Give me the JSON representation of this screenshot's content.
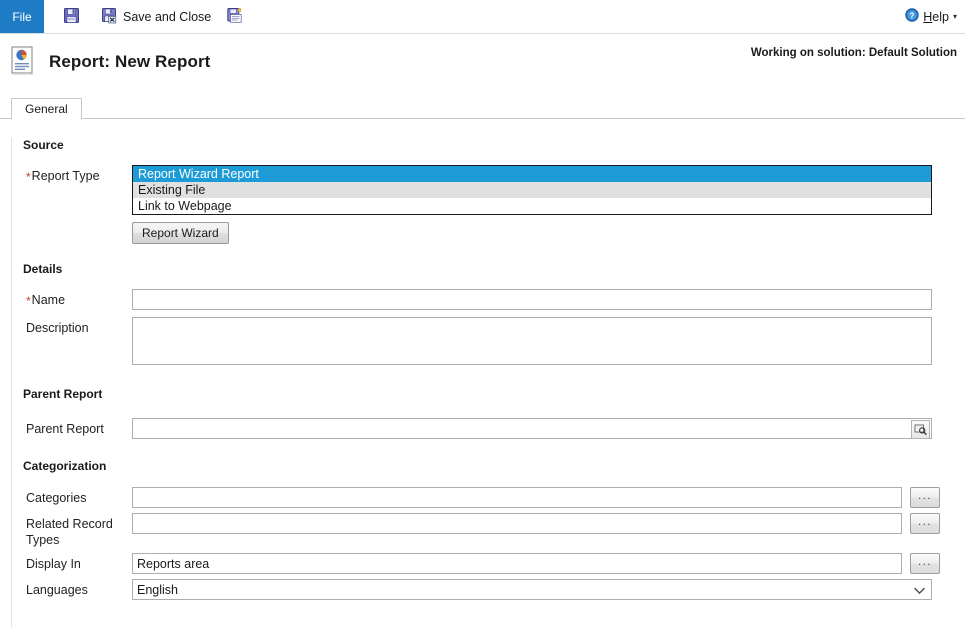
{
  "ribbon": {
    "file_tab": "File",
    "commands": [
      {
        "name": "save",
        "label": "",
        "icon": "save-icon"
      },
      {
        "name": "save-and-close",
        "label": "Save and Close",
        "icon": "save-and-close-icon"
      },
      {
        "name": "save-and-new",
        "label": "",
        "icon": "save-and-new-icon"
      }
    ],
    "help_label": "Help",
    "help_accesskey": "H",
    "help_caret": "▾"
  },
  "header": {
    "title": "Report: New Report",
    "icon": "report-document-icon",
    "solution_note": "Working on solution: Default Solution"
  },
  "tabs": [
    {
      "label": "General",
      "selected": true
    }
  ],
  "form": {
    "sections": {
      "source": {
        "heading": "Source",
        "report_type": {
          "label": "Report Type",
          "required": true,
          "options": [
            "Report Wizard Report",
            "Existing File",
            "Link to Webpage"
          ],
          "selected_index": 0
        },
        "wizard_button": "Report Wizard"
      },
      "details": {
        "heading": "Details",
        "name": {
          "label": "Name",
          "required": true,
          "value": "",
          "placeholder": ""
        },
        "description": {
          "label": "Description",
          "required": false,
          "value": "",
          "placeholder": ""
        }
      },
      "parent_report": {
        "heading": "Parent Report",
        "field": {
          "label": "Parent Report",
          "required": false,
          "value": "",
          "placeholder": ""
        },
        "lookup_icon": "lookup-magnifier-icon"
      },
      "categorization": {
        "heading": "Categorization",
        "rows": [
          {
            "label": "Categories",
            "value": "",
            "button": "..."
          },
          {
            "label": "Related Record Types",
            "value": "",
            "button": "..."
          },
          {
            "label": "Display In",
            "value": "Reports area",
            "button": "..."
          }
        ],
        "languages": {
          "label": "Languages",
          "value": "English",
          "options": [
            "English"
          ],
          "caret": "⌄"
        }
      }
    }
  },
  "colors": {
    "file_tab_blue": "#1d7cc4",
    "selection_blue": "#1d9bd7",
    "alt_row_gray": "#e0e0e0",
    "required_red": "#cf3b2f",
    "border_gray": "#aeaeae"
  }
}
